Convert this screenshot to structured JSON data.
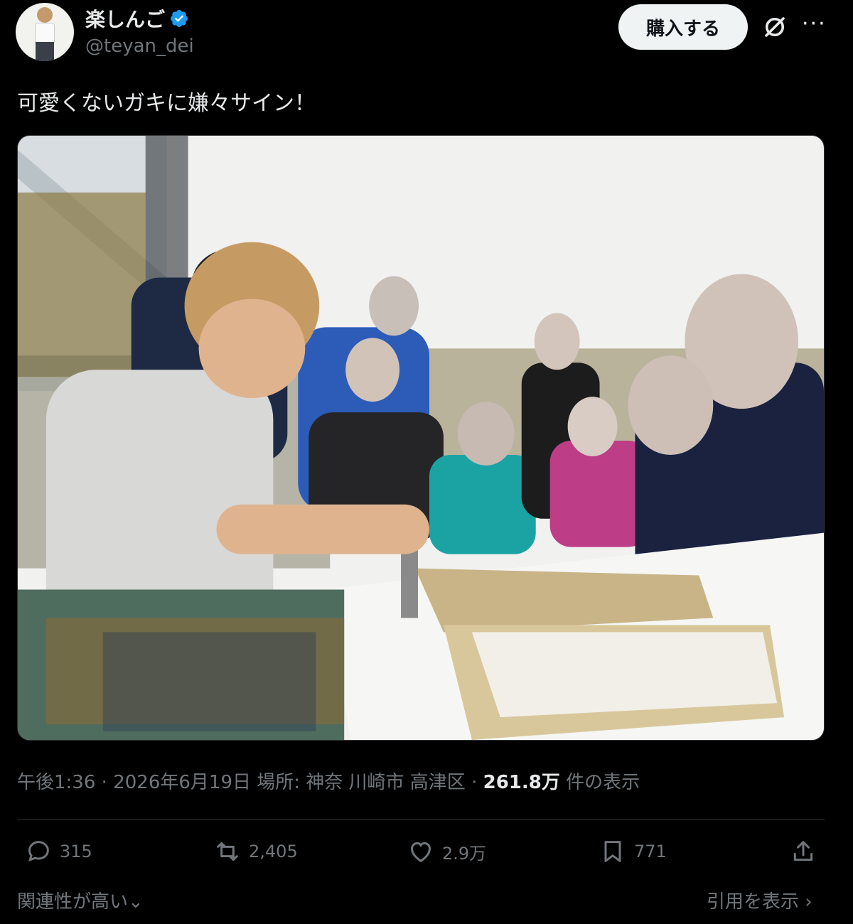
{
  "author": {
    "display_name": "楽しんご",
    "handle": "@teyan_dei",
    "verified": true
  },
  "header": {
    "buy_label": "購入する"
  },
  "post": {
    "text": "可愛くないガキに嫌々サイン！",
    "time": "午後1:36",
    "date": "2026年6月19日",
    "location_label": "場所:",
    "location": "神奈 川崎市 高津区",
    "separator": "·",
    "views_count": "261.8万",
    "views_label": "件の表示"
  },
  "actions": {
    "replies": "315",
    "reposts": "2,405",
    "likes": "2.9万",
    "bookmarks": "771"
  },
  "footer": {
    "sort_label": "関連性が高い",
    "quotes_label": "引用を表示"
  },
  "colors": {
    "background": "#000000",
    "text": "#e7e9ea",
    "muted": "#71767b",
    "verified": "#1d9bf0",
    "button_bg": "#eff3f4"
  }
}
